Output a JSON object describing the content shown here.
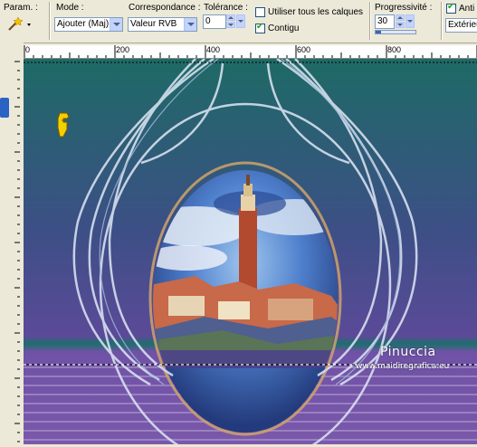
{
  "toolbar": {
    "param_label": "Param. :",
    "mode_label": "Mode :",
    "mode_value": "Ajouter (Maj)",
    "match_label": "Correspondance :",
    "match_value": "Valeur RVB",
    "tolerance_label": "Tolérance :",
    "tolerance_value": "0",
    "use_all_layers_label": "Utiliser tous les calques",
    "use_all_layers_checked": false,
    "contiguous_label": "Contigu",
    "contiguous_checked": true,
    "feather_label": "Progressivité :",
    "feather_value": "30",
    "antialias_label": "Anti",
    "antialias_checked": true,
    "antialias_value": "Extérieu"
  },
  "ruler": {
    "ticks": [
      "0",
      "200",
      "400",
      "600",
      "800"
    ]
  },
  "canvas": {
    "watermark_name": "Pinuccia",
    "watermark_url": "www.maidiregrafica.eu"
  },
  "colors": {
    "top_bg": "#1e6a66",
    "bottom_bg": "#6b4fa0",
    "accent": "#f2c20a"
  }
}
